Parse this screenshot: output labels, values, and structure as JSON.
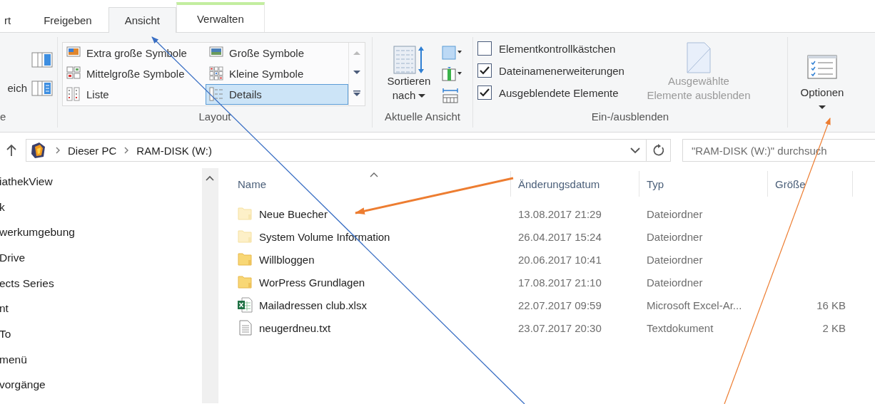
{
  "tabs": [
    {
      "label": "rt",
      "selected": false,
      "kind": "normal"
    },
    {
      "label": "Freigeben",
      "selected": false,
      "kind": "normal"
    },
    {
      "label": "Ansicht",
      "selected": true,
      "kind": "normal"
    },
    {
      "label": "Verwalten",
      "selected": false,
      "kind": "contextual"
    }
  ],
  "ribbon": {
    "panes": {
      "label": "e",
      "button": "eich"
    },
    "layout": {
      "label": "Layout",
      "options": [
        {
          "label": "Extra große Symbole",
          "selected": false,
          "kind": "xl"
        },
        {
          "label": "Große Symbole",
          "selected": false,
          "kind": "large"
        },
        {
          "label": "Mittelgroße Symbole",
          "selected": false,
          "kind": "medium"
        },
        {
          "label": "Kleine Symbole",
          "selected": false,
          "kind": "small"
        },
        {
          "label": "Liste",
          "selected": false,
          "kind": "list"
        },
        {
          "label": "Details",
          "selected": true,
          "kind": "details"
        }
      ]
    },
    "current_view": {
      "label": "Aktuelle Ansicht",
      "sort_button": "Sortieren nach"
    },
    "show_hide": {
      "label": "Ein-/ausblenden",
      "checkboxes": [
        {
          "label": "Elementkontrollkästchen",
          "checked": false
        },
        {
          "label": "Dateinamenerweiterungen",
          "checked": true
        },
        {
          "label": "Ausgeblendete Elemente",
          "checked": true
        }
      ],
      "hide_selected": {
        "label": "Ausgewählte Elemente ausblenden",
        "disabled": true
      }
    },
    "options": {
      "label": "Optionen"
    }
  },
  "address": {
    "breadcrumbs": [
      "Dieser PC",
      "RAM-DISK (W:)"
    ],
    "search_placeholder": "\"RAM-DISK (W:)\" durchsuch"
  },
  "nav_items": [
    "iathekView",
    "k",
    "werkumgebung",
    "Drive",
    "ects Series",
    "nt",
    "To",
    "menü",
    "vorgänge"
  ],
  "columns": [
    {
      "label": "Name",
      "sorted": true
    },
    {
      "label": "Änderungsdatum",
      "sorted": false
    },
    {
      "label": "Typ",
      "sorted": false
    },
    {
      "label": "Größe",
      "sorted": false
    }
  ],
  "rows": [
    {
      "kind": "folder",
      "hidden": true,
      "name": "Neue Buecher",
      "date": "13.08.2017 21:29",
      "type": "Dateiordner",
      "size": ""
    },
    {
      "kind": "folder",
      "hidden": true,
      "name": "System Volume Information",
      "date": "26.04.2017 15:24",
      "type": "Dateiordner",
      "size": ""
    },
    {
      "kind": "folder",
      "hidden": false,
      "name": "Willbloggen",
      "date": "20.06.2017 10:41",
      "type": "Dateiordner",
      "size": ""
    },
    {
      "kind": "folder",
      "hidden": false,
      "name": "WorPress Grundlagen",
      "date": "17.08.2017 21:10",
      "type": "Dateiordner",
      "size": ""
    },
    {
      "kind": "excel",
      "hidden": false,
      "name": "Mailadressen club.xlsx",
      "date": "22.07.2017 09:59",
      "type": "Microsoft Excel-Ar...",
      "size": "16 KB"
    },
    {
      "kind": "text",
      "hidden": false,
      "name": "neugerdneu.txt",
      "date": "23.07.2017 20:30",
      "type": "Textdokument",
      "size": "2 KB"
    }
  ]
}
